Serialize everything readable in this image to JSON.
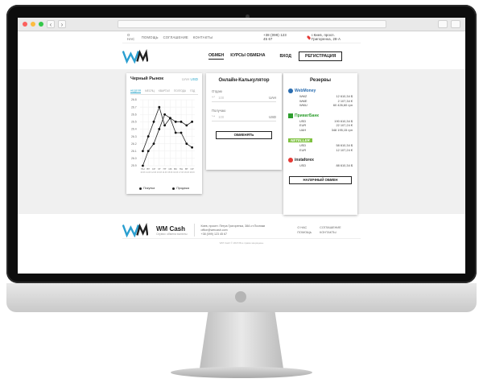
{
  "top_nav": {
    "links": [
      "О НАС",
      "ПОМОЩЬ",
      "СОГЛАШЕНИЕ",
      "КОНТАКТЫ"
    ],
    "phone": "+38 (099) 123 45 67",
    "location": "г.Киев, просп. Григоренка, 28-А"
  },
  "header": {
    "logo_tagline": "Сервис обмена валюты",
    "nav": [
      "ОБМЕН",
      "КУРСЫ ОБМЕНА"
    ],
    "login": "ВХОД",
    "register": "РЕГИСТРАЦИЯ"
  },
  "market": {
    "title": "Черный Рынок",
    "currencies": [
      "UAH",
      "USD"
    ],
    "tabs": [
      "НЕДЕЛЯ",
      "МЕСЯЦ",
      "КВАРТАЛ",
      "ПОЛГОДА",
      "ГОД"
    ],
    "legend_buy": "Покупка",
    "legend_sell": "Продажа"
  },
  "calculator": {
    "title": "Онлайн-Калькулятор",
    "give_label": "Отдаю",
    "give_placeholder": "100",
    "give_currency": "UAH",
    "receive_label": "Получаю",
    "receive_placeholder": "100",
    "receive_currency": "USD",
    "button": "ОБМЕНЯТЬ"
  },
  "reserves": {
    "title": "Резервы",
    "groups": [
      {
        "brand": "WebMoney",
        "rows": [
          [
            "WMZ",
            "12 610,34 $"
          ],
          [
            "WME",
            "2 107,34 €"
          ],
          [
            "WMU",
            "60 426,60 грн"
          ]
        ]
      },
      {
        "brand": "ПриватБанк",
        "rows": [
          [
            "USD",
            "190 610,34 $"
          ],
          [
            "EUR",
            "22 107,24 €"
          ],
          [
            "UAH",
            "348 195,15 грн"
          ]
        ]
      },
      {
        "brand": "NETELLER",
        "rows": [
          [
            "USD",
            "58 610,34 $"
          ],
          [
            "EUR",
            "12 107,24 €"
          ]
        ]
      },
      {
        "brand": "instaforex",
        "rows": [
          [
            "USD",
            "88 610,34 $"
          ]
        ]
      }
    ],
    "button": "НАЛИЧНЫЙ ОБМЕН"
  },
  "footer": {
    "brand": "WM Cash",
    "tagline": "Сервис обмена валюты",
    "address": "Киев, проспт. Петра Григоренка, 38А ст.Позняки",
    "email": "office@wmcash.com",
    "phone": "+38 (099) 123 45 67",
    "links": [
      "О НАС",
      "СОГЛАШЕНИЕ",
      "ПОМОЩЬ",
      "КОНТАКТЫ"
    ],
    "copyright": "WM Cash © 2015 Все права защищены"
  },
  "chart_data": {
    "type": "line",
    "categories": [
      "ПН",
      "ВТ",
      "СР",
      "ЧТ",
      "ПТ",
      "СБ",
      "ВС",
      "ПН",
      "ВТ",
      "СР"
    ],
    "x_sub_labels": [
      "10.03",
      "11.03",
      "12.03",
      "13.03",
      "14.03",
      "15.03",
      "16.03",
      "17.03",
      "18.03",
      "19.03"
    ],
    "y_ticks": [
      "26.8",
      "26.7",
      "26.6",
      "26.5",
      "26.4",
      "26.3",
      "26.2",
      "26.1",
      "26.0",
      "25.9"
    ],
    "ylim": [
      25.9,
      26.8
    ],
    "series": [
      {
        "name": "Покупка",
        "values": [
          25.9,
          26.1,
          26.2,
          26.4,
          26.6,
          26.55,
          26.35,
          26.35,
          26.2,
          26.15
        ]
      },
      {
        "name": "Продажа",
        "values": [
          26.1,
          26.3,
          26.5,
          26.7,
          26.45,
          26.55,
          26.5,
          26.5,
          26.45,
          26.5
        ]
      }
    ]
  }
}
